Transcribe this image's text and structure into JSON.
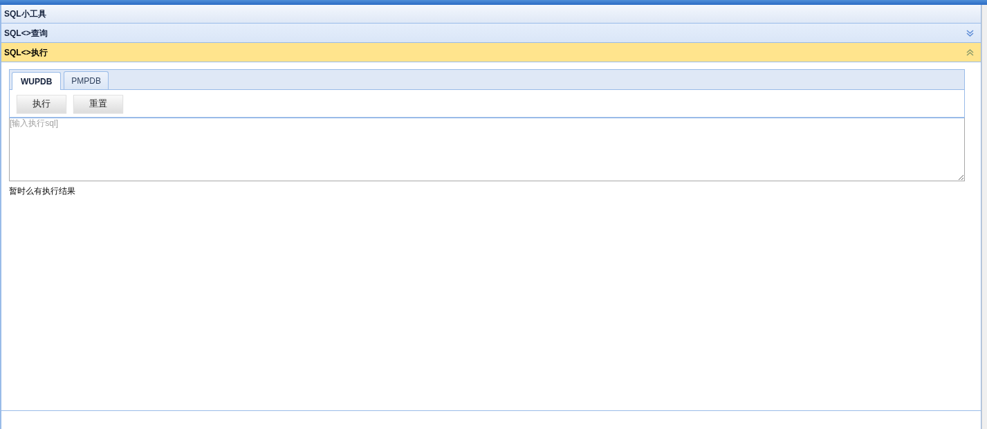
{
  "panel": {
    "title": "SQL小工具"
  },
  "accordion": [
    {
      "title": "SQL<>查询",
      "expanded": false
    },
    {
      "title": "SQL<>执行",
      "expanded": true
    }
  ],
  "tabs": [
    {
      "label": "WUPDB",
      "selected": true
    },
    {
      "label": "PMPDB",
      "selected": false
    }
  ],
  "buttons": [
    "执行",
    "重置"
  ],
  "sql_input": {
    "placeholder": "[输入执行sql]"
  },
  "result_message": "暂时么有执行结果"
}
